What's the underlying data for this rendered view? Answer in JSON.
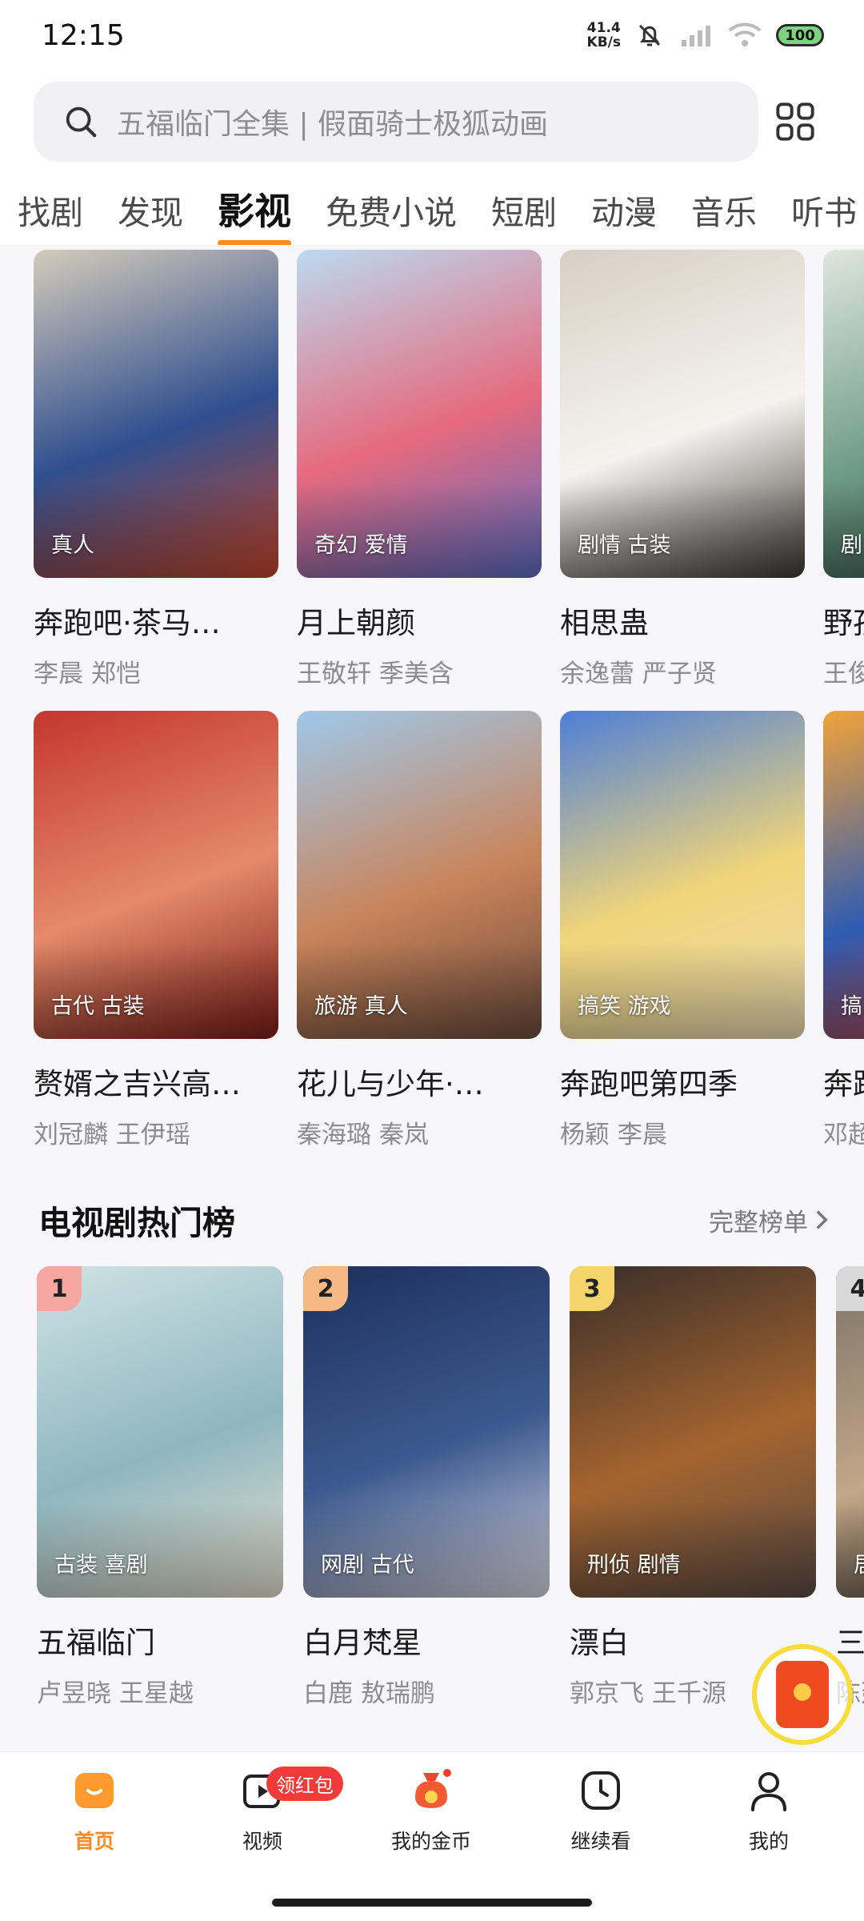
{
  "status_bar": {
    "time": "12:15",
    "net_speed_value": "41.4",
    "net_speed_unit": "KB/s",
    "battery": "100"
  },
  "search": {
    "placeholder": "五福临门全集 | 假面骑士极狐动画"
  },
  "tabs": [
    {
      "label": "找剧",
      "active": false
    },
    {
      "label": "发现",
      "active": false
    },
    {
      "label": "影视",
      "active": true
    },
    {
      "label": "免费小说",
      "active": false
    },
    {
      "label": "短剧",
      "active": false
    },
    {
      "label": "动漫",
      "active": false
    },
    {
      "label": "音乐",
      "active": false
    },
    {
      "label": "听书",
      "active": false
    }
  ],
  "row1": [
    {
      "tags": "真人",
      "title": "奔跑吧·茶马…",
      "cast": "李晨 郑恺",
      "colors": [
        "#d5cbbb",
        "#2f4f8f",
        "#c4452a"
      ]
    },
    {
      "tags": "奇幻 爱情",
      "title": "月上朝颜",
      "cast": "王敬轩 季美含",
      "colors": [
        "#bcdaf0",
        "#e66a7e",
        "#5b6bc2"
      ]
    },
    {
      "tags": "剧情 古装",
      "title": "相思蛊",
      "cast": "余逸蕾 严子贤",
      "colors": [
        "#d8cfc3",
        "#f5f3ef",
        "#3a3632"
      ]
    },
    {
      "tags": "剧",
      "title": "野孩",
      "cast": "王俊",
      "colors": [
        "#dfe6de",
        "#6f9c89",
        "#2e4e46"
      ]
    }
  ],
  "row2": [
    {
      "tags": "古代 古装",
      "title": "赘婿之吉兴高…",
      "cast": "刘冠麟 王伊瑶",
      "colors": [
        "#c5362e",
        "#e48a6a",
        "#7a1c18"
      ]
    },
    {
      "tags": "旅游 真人",
      "title": "花儿与少年·…",
      "cast": "秦海璐 秦岚",
      "colors": [
        "#9fc8ea",
        "#c9845b",
        "#6b4a3c"
      ]
    },
    {
      "tags": "搞笑 游戏",
      "title": "奔跑吧第四季",
      "cast": "杨颖 李晨",
      "colors": [
        "#4d7fd8",
        "#f1d57a",
        "#ead9b0"
      ]
    },
    {
      "tags": "搞",
      "title": "奔跑",
      "cast": "邓超",
      "colors": [
        "#f2a33a",
        "#2e5bb2",
        "#d8442f"
      ]
    }
  ],
  "hot_section": {
    "title": "电视剧热门榜",
    "more": "完整榜单",
    "items": [
      {
        "rank": "1",
        "tags": "古装 喜剧",
        "title": "五福临门",
        "cast": "卢昱晓 王星越",
        "badge_color": "#f7a7a1",
        "colors": [
          "#cfe3e4",
          "#8fb6c0",
          "#e6e1d0"
        ]
      },
      {
        "rank": "2",
        "tags": "网剧 古代",
        "title": "白月梵星",
        "cast": "白鹿 敖瑞鹏",
        "badge_color": "#f6b985",
        "colors": [
          "#1d2f5c",
          "#3c5a8f",
          "#d8d5e0"
        ]
      },
      {
        "rank": "3",
        "tags": "刑侦 剧情",
        "title": "漂白",
        "cast": "郭京飞 王千源",
        "badge_color": "#f5d56b",
        "colors": [
          "#3a2e2a",
          "#a4642f",
          "#5a4a44"
        ]
      },
      {
        "rank": "4",
        "tags": "居",
        "title": "三",
        "cast": "陈建",
        "badge_color": "#d8d8d8",
        "colors": [
          "#7b7368",
          "#c4a788",
          "#3f3a34"
        ]
      }
    ]
  },
  "bottom_nav": [
    {
      "label": "首页",
      "icon": "home-icon",
      "active": true
    },
    {
      "label": "视频",
      "icon": "video-icon",
      "active": false,
      "badge": "领红包"
    },
    {
      "label": "我的金币",
      "icon": "coin-bag-icon",
      "active": false
    },
    {
      "label": "继续看",
      "icon": "clock-icon",
      "active": false
    },
    {
      "label": "我的",
      "icon": "profile-icon",
      "active": false
    }
  ],
  "accent_color": "#ff8a1f"
}
